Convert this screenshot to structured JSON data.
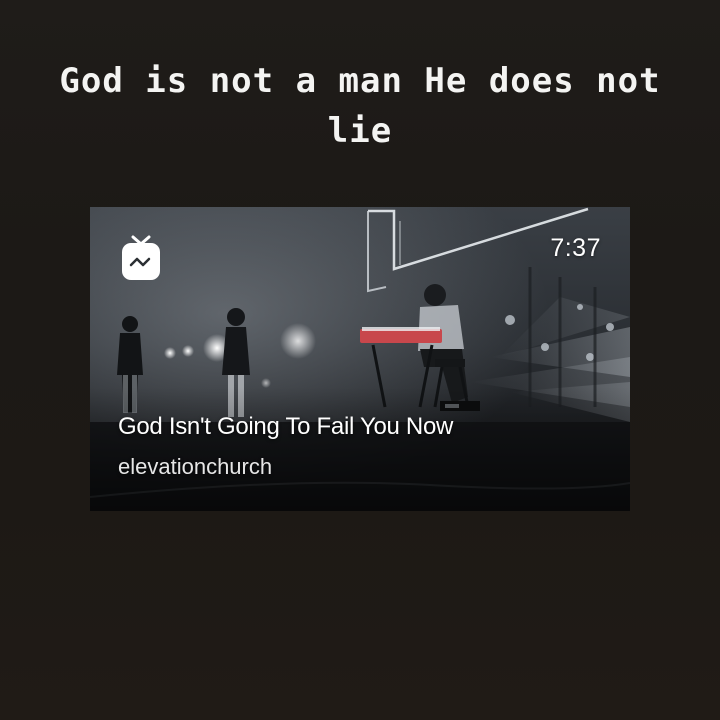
{
  "story": {
    "caption": "God is not a man He does not lie"
  },
  "video": {
    "duration": "7:37",
    "title": "God Isn't Going To Fail You Now",
    "author": "elevationchurch",
    "app_icon": "igtv-icon"
  },
  "colors": {
    "background": "#1e1a16",
    "caption_text": "#f4f4f2",
    "overlay_text": "#ffffff"
  }
}
